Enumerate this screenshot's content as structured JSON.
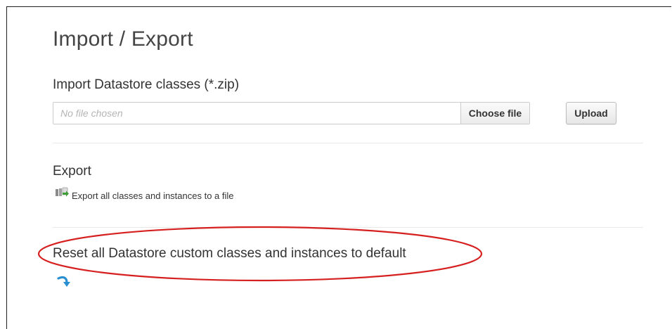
{
  "page": {
    "title": "Import / Export"
  },
  "import": {
    "heading": "Import Datastore classes (*.zip)",
    "file_placeholder": "No file chosen",
    "choose_file_label": "Choose file",
    "upload_label": "Upload"
  },
  "export": {
    "heading": "Export",
    "link_label": "Export all classes and instances to a file",
    "icon": "export-classes-icon"
  },
  "reset": {
    "heading": "Reset all Datastore custom classes and instances to default",
    "icon": "reset-arrow-icon"
  },
  "colors": {
    "annotation": "#d62020",
    "reset_icon": "#2a8fd1",
    "export_icon_green": "#3f9d3a",
    "export_icon_gray": "#8a8a8a"
  }
}
